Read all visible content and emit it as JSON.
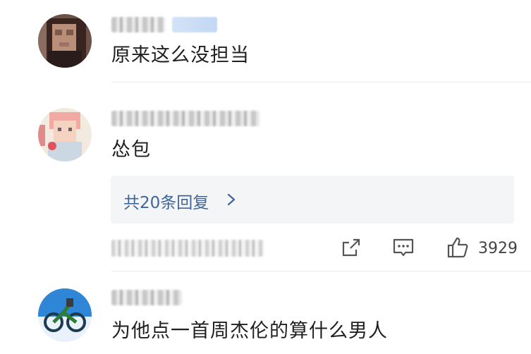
{
  "comments": [
    {
      "content": "原来这么没担当"
    },
    {
      "content": "怂包",
      "reply_label": "共20条回复",
      "like_count": "3929"
    },
    {
      "content": "为他点一首周杰伦的算什么男人"
    }
  ],
  "icons": {
    "share": "share-icon",
    "comment": "comment-icon",
    "like": "thumbs-up-icon",
    "reply_chevron": "chevron-right-icon"
  },
  "colors": {
    "reply_link": "#406599",
    "reply_box_bg": "#f4f5f7",
    "divider": "#ececec",
    "icon": "#555555"
  }
}
